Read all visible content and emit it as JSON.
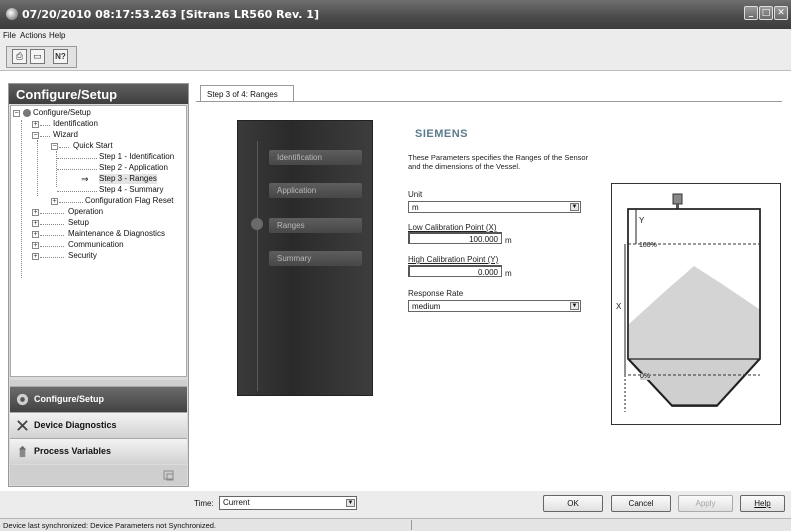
{
  "window": {
    "title": "07/20/2010 08:17:53.263 [Sitrans LR560 Rev. 1]",
    "minimize_glyph": "_",
    "maximize_glyph": "□",
    "close_glyph": "✕"
  },
  "menu": {
    "file": "File",
    "actions": "Actions",
    "help": "Help"
  },
  "toolbar": {
    "icons": [
      "printer-icon",
      "print-preview-icon",
      "context-help-icon"
    ],
    "print_glyph": "⎙",
    "preview_glyph": "▭",
    "help_glyph": "N?"
  },
  "left_panel": {
    "header": "Configure/Setup",
    "tree": {
      "root": "Configure/Setup",
      "identification": "Identification",
      "wizard": "Wizard",
      "quick_start": "Quick Start",
      "step1": "Step 1 - Identification",
      "step2": "Step 2 - Application",
      "step3": "Step 3 - Ranges",
      "step4": "Step 4 - Summary",
      "config_flag_reset": "Configuration Flag Reset",
      "operation": "Operation",
      "setup": "Setup",
      "maintenance": "Maintenance & Diagnostics",
      "communication": "Communication",
      "security": "Security",
      "selected_arrow": "⇒"
    },
    "nav": {
      "configure": "Configure/Setup",
      "diagnostics": "Device Diagnostics",
      "process_vars": "Process Variables"
    }
  },
  "tab": {
    "label": "Step 3 of 4: Ranges"
  },
  "wizard_steps": [
    "Identification",
    "Application",
    "Ranges",
    "Summary"
  ],
  "form": {
    "brand": "SIEMENS",
    "description": "These Parameters specifies the Ranges of the Sensor and the dimensions of the Vessel.",
    "unit_label": "Unit",
    "unit_value": "m",
    "low_cal_label": "Low Calibration Point (X)",
    "low_cal_value": "100.000",
    "low_cal_unit": "m",
    "high_cal_label": "High Calibration Point (Y)",
    "high_cal_value": "0.000",
    "high_cal_unit": "m",
    "response_label": "Response Rate",
    "response_value": "medium"
  },
  "diagram": {
    "y_label": "Y",
    "x_label": "X",
    "level_100": "100%",
    "level_0": "0%"
  },
  "bottom": {
    "time_label": "Time:",
    "time_value": "Current",
    "ok": "OK",
    "cancel": "Cancel",
    "apply": "Apply",
    "help": "Help"
  },
  "status": {
    "text": "Device last synchronized: Device Parameters not Synchronized."
  },
  "colors": {
    "header_dark": "#4a4a4a",
    "brand": "#5a7b8c",
    "wizard_bg": "#2f2f2f"
  }
}
